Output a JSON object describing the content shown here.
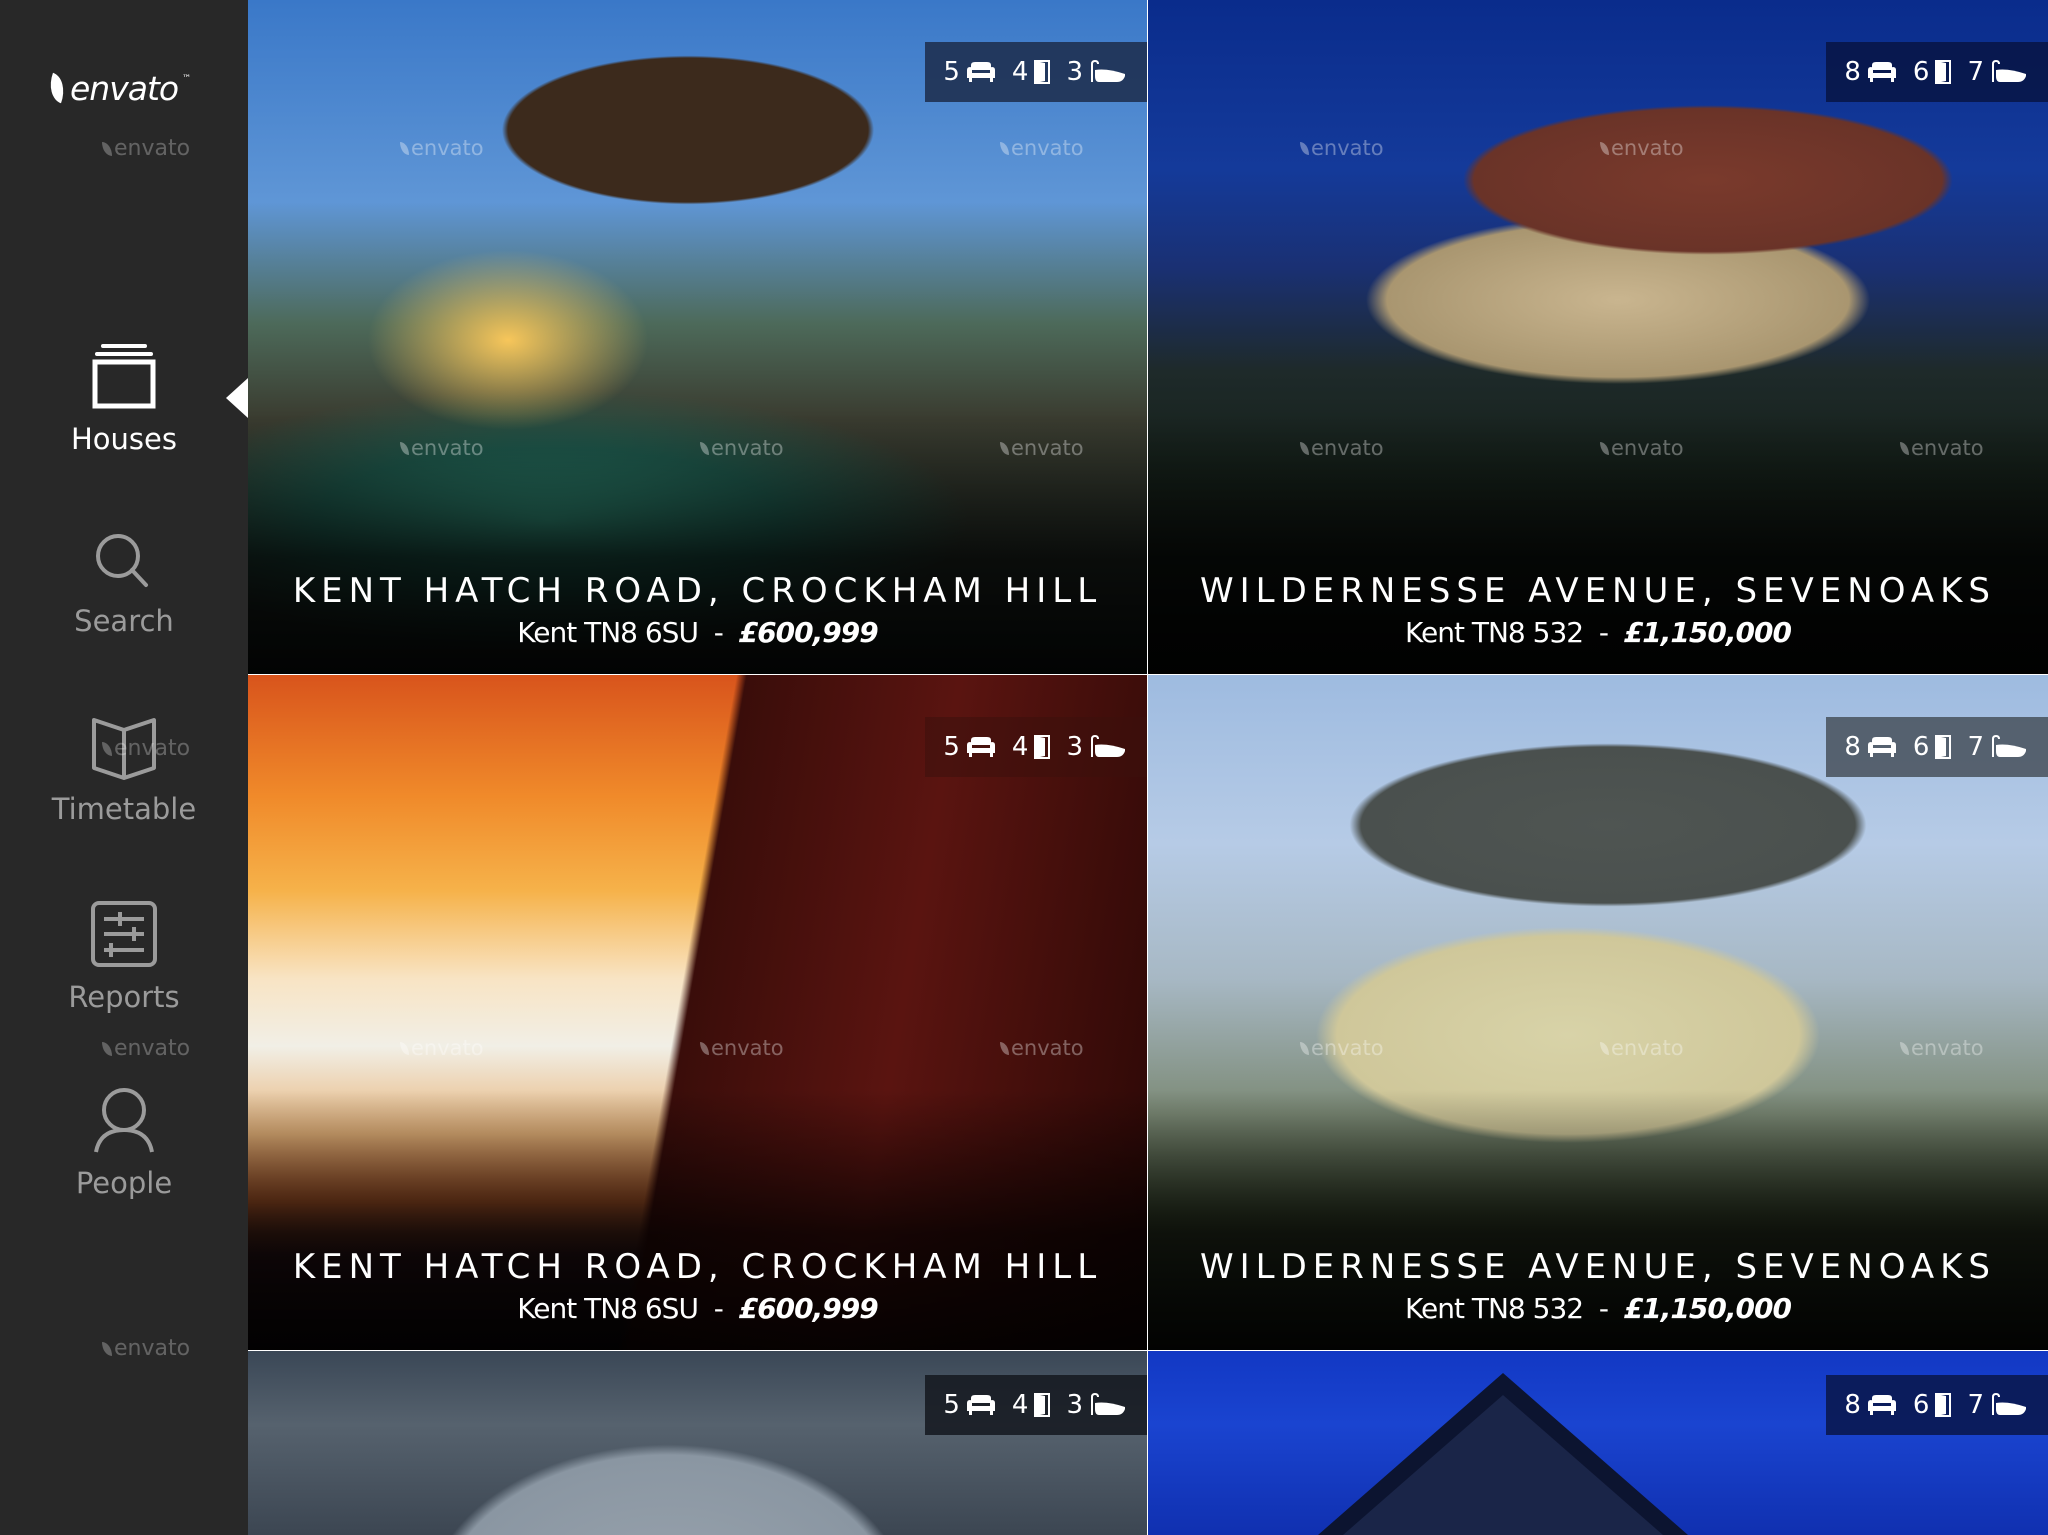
{
  "brand": {
    "logo_text": "envato",
    "trademark": "™",
    "watermark_text": "envato"
  },
  "sidebar": {
    "items": [
      {
        "label": "Houses",
        "icon": "stack-icon",
        "active": true
      },
      {
        "label": "Search",
        "icon": "search-icon",
        "active": false
      },
      {
        "label": "Timetable",
        "icon": "book-icon",
        "active": false
      },
      {
        "label": "Reports",
        "icon": "sliders-icon",
        "active": false
      },
      {
        "label": "People",
        "icon": "person-icon",
        "active": false
      }
    ]
  },
  "colors": {
    "sidebar_bg": "#282828",
    "nav_active": "#ffffff",
    "nav_inactive": "#9b9b9b",
    "badge_bg": "#1e2a44"
  },
  "listings": [
    {
      "title": "KENT HATCH ROAD, CROCKHAM HILL",
      "location": "Kent TN8 6SU",
      "separator": "-",
      "price": "£600,999",
      "living_rooms": "5",
      "rooms": "4",
      "bathrooms": "3"
    },
    {
      "title": "WILDERNESSE AVENUE, SEVENOAKS",
      "location": "Kent TN8 532",
      "separator": "-",
      "price": "£1,150,000",
      "living_rooms": "8",
      "rooms": "6",
      "bathrooms": "7"
    },
    {
      "title": "KENT HATCH ROAD, CROCKHAM HILL",
      "location": "Kent TN8 6SU",
      "separator": "-",
      "price": "£600,999",
      "living_rooms": "5",
      "rooms": "4",
      "bathrooms": "3"
    },
    {
      "title": "WILDERNESSE AVENUE, SEVENOAKS",
      "location": "Kent TN8 532",
      "separator": "-",
      "price": "£1,150,000",
      "living_rooms": "8",
      "rooms": "6",
      "bathrooms": "7"
    },
    {
      "title": "",
      "location": "",
      "separator": "",
      "price": "",
      "living_rooms": "5",
      "rooms": "4",
      "bathrooms": "3"
    },
    {
      "title": "",
      "location": "",
      "separator": "",
      "price": "",
      "living_rooms": "8",
      "rooms": "6",
      "bathrooms": "7"
    }
  ]
}
